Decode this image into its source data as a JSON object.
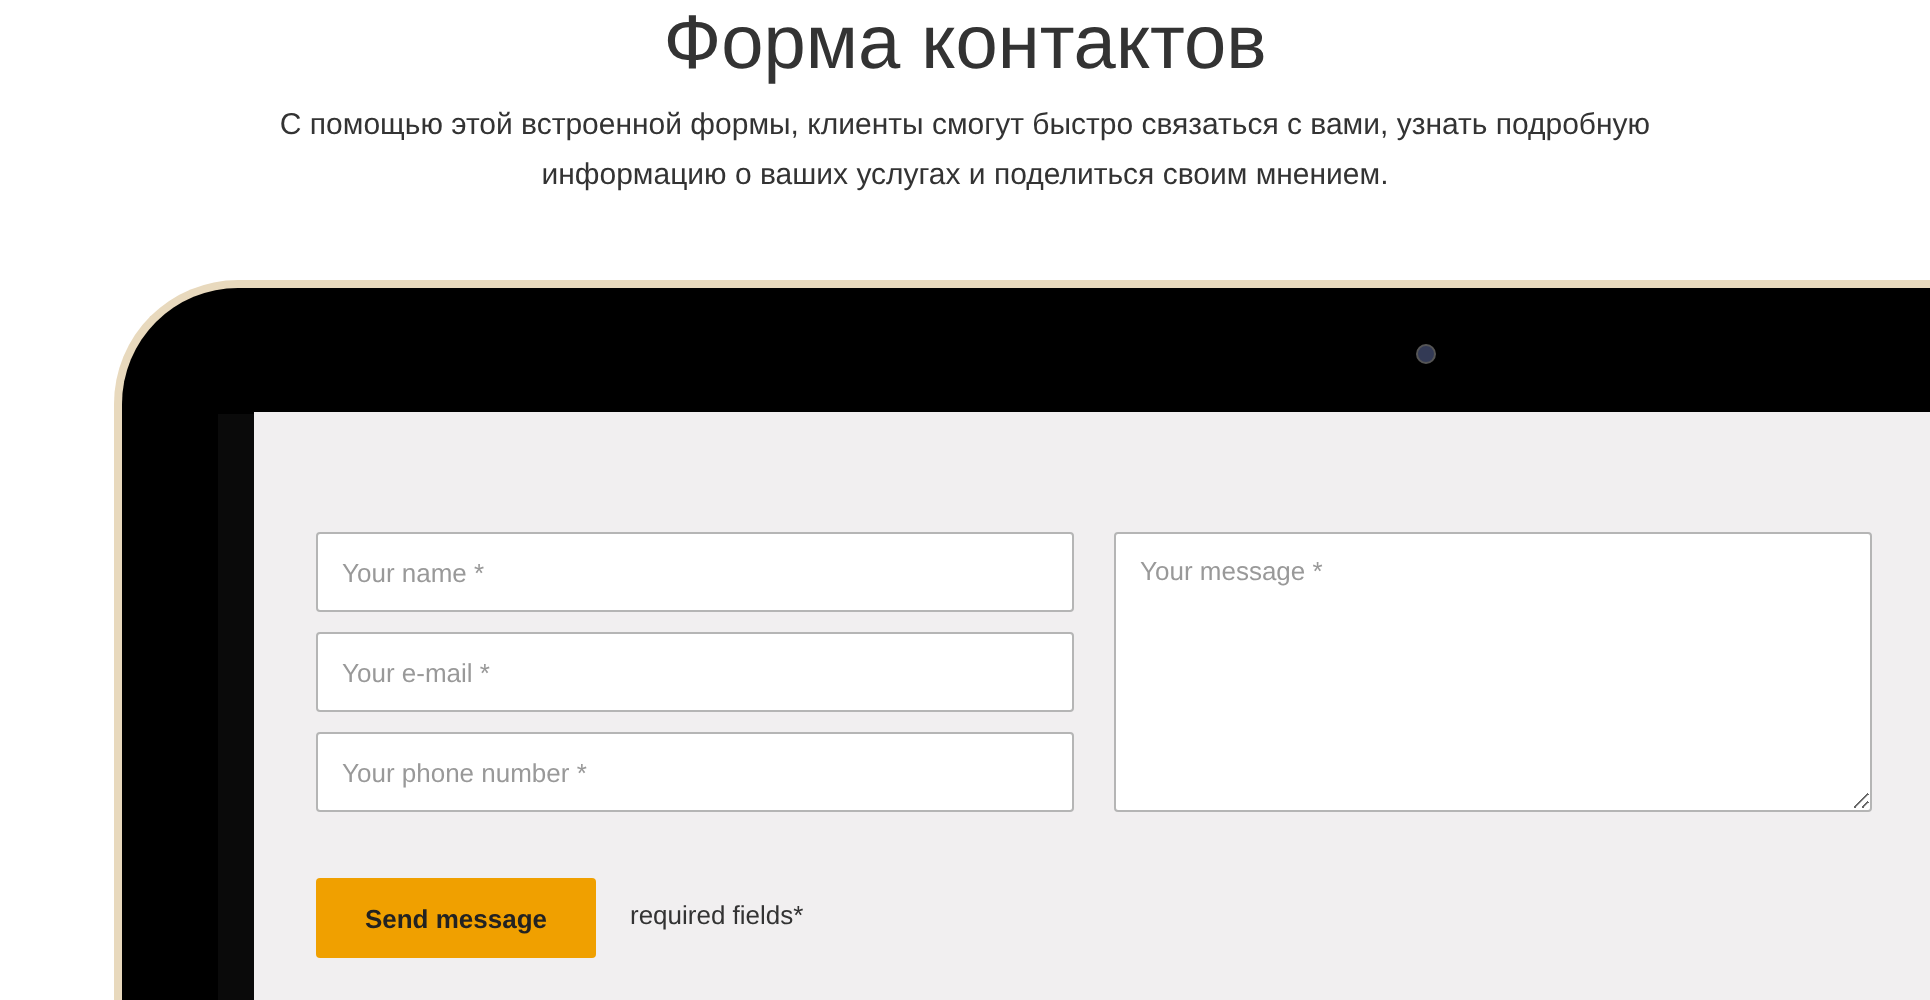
{
  "header": {
    "title": "Форма контактов",
    "description": "С помощью этой встроенной формы, клиенты смогут быстро связаться с вами, узнать подробную информацию о ваших услугах и поделиться своим мнением."
  },
  "form": {
    "fields": [
      {
        "kind": "input",
        "placeholder": "Your name *"
      },
      {
        "kind": "input",
        "placeholder": "Your e-mail *"
      },
      {
        "kind": "input",
        "placeholder": "Your phone number *"
      },
      {
        "kind": "textarea",
        "placeholder": "Your message *"
      }
    ],
    "submit": "Send message",
    "note": "required fields*"
  }
}
